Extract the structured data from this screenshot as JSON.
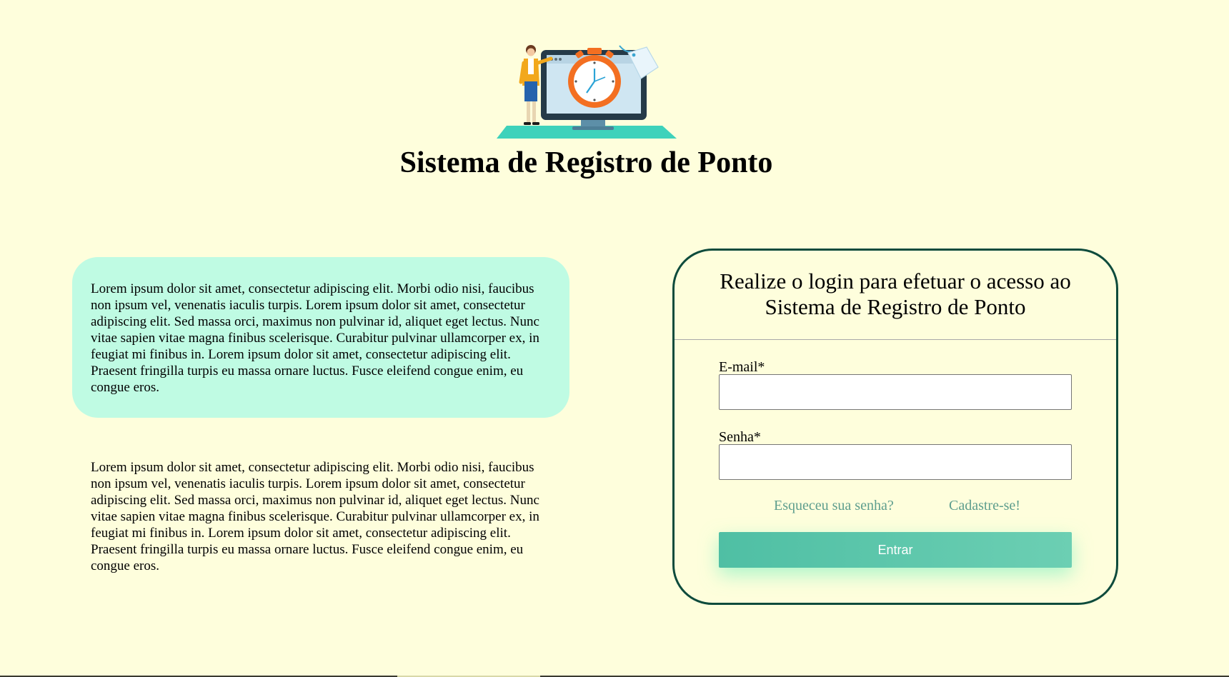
{
  "header": {
    "illustration_icon": "timekeeping-illustration",
    "title": "Sistema de Registro de Ponto"
  },
  "info": {
    "highlight_text": "Lorem ipsum dolor sit amet, consectetur adipiscing elit. Morbi odio nisi, faucibus non ipsum vel, venenatis iaculis turpis. Lorem ipsum dolor sit amet, consectetur adipiscing elit. Sed massa orci, maximus non pulvinar id, aliquet eget lectus. Nunc vitae sapien vitae magna finibus scelerisque. Curabitur pulvinar ullamcorper ex, in feugiat mi finibus in. Lorem ipsum dolor sit amet, consectetur adipiscing elit. Praesent fringilla turpis eu massa ornare luctus. Fusce eleifend congue enim, eu congue eros.",
    "plain_text": "Lorem ipsum dolor sit amet, consectetur adipiscing elit. Morbi odio nisi, faucibus non ipsum vel, venenatis iaculis turpis. Lorem ipsum dolor sit amet, consectetur adipiscing elit. Sed massa orci, maximus non pulvinar id, aliquet eget lectus. Nunc vitae sapien vitae magna finibus scelerisque. Curabitur pulvinar ullamcorper ex, in feugiat mi finibus in. Lorem ipsum dolor sit amet, consectetur adipiscing elit. Praesent fringilla turpis eu massa ornare luctus. Fusce eleifend congue enim, eu congue eros."
  },
  "login": {
    "heading": "Realize o login para efetuar o acesso ao Sistema de Registro de Ponto",
    "email_label": "E-mail*",
    "email_value": "",
    "password_label": "Senha*",
    "password_value": "",
    "forgot_link": "Esqueceu sua senha?",
    "signup_link": "Cadastre-se!",
    "submit_label": "Entrar"
  },
  "colors": {
    "page_background": "#fefedc",
    "highlight_box": "#bffbe3",
    "card_border": "#0e4b3c",
    "link": "#5e9e8e",
    "button_start": "#4fbfa4",
    "button_end": "#6ccfb3"
  }
}
